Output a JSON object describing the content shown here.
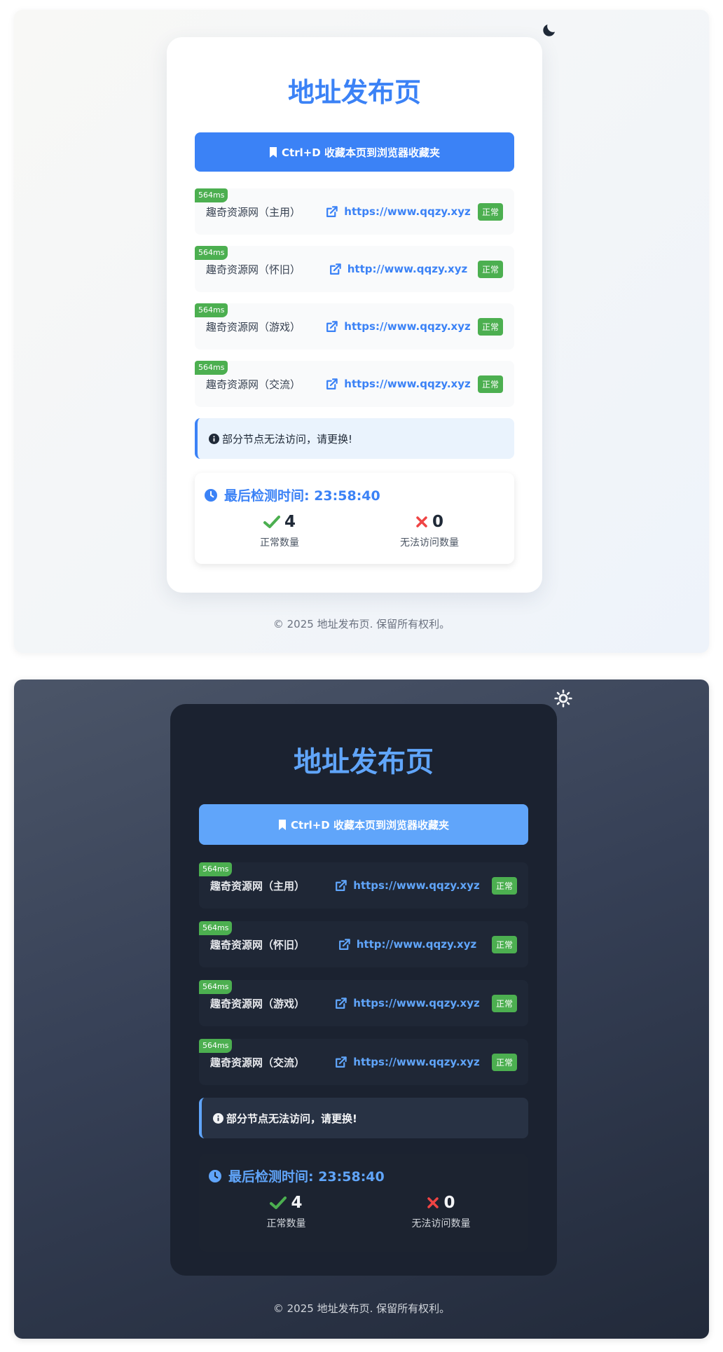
{
  "page": {
    "title": "地址发布页"
  },
  "bookmark": {
    "label": "Ctrl+D 收藏本页到浏览器收藏夹"
  },
  "sites": [
    {
      "latency": "564ms",
      "name": "趣奇资源网（主用）",
      "url": "https://www.qqzy.xyz",
      "status": "正常"
    },
    {
      "latency": "564ms",
      "name": "趣奇资源网（怀旧）",
      "url": "http://www.qqzy.xyz",
      "status": "正常"
    },
    {
      "latency": "564ms",
      "name": "趣奇资源网（游戏）",
      "url": "https://www.qqzy.xyz",
      "status": "正常"
    },
    {
      "latency": "564ms",
      "name": "趣奇资源网（交流）",
      "url": "https://www.qqzy.xyz",
      "status": "正常"
    }
  ],
  "notice": {
    "text": "部分节点无法访问，请更换!"
  },
  "stats": {
    "last_check": "最后检测时间: 23:58:40",
    "ok_count": "4",
    "ok_label": "正常数量",
    "fail_count": "0",
    "fail_label": "无法访问数量"
  },
  "footer": {
    "text": "© 2025 地址发布页. 保留所有权利。"
  },
  "icons": {
    "theme_light": "moon-icon",
    "theme_dark": "sun-icon",
    "bookmark": "bookmark-icon",
    "link": "external-link-icon",
    "notice": "info-circle-icon",
    "clock": "clock-icon",
    "ok": "check-icon",
    "fail": "x-icon"
  },
  "colors": {
    "accent_light": "#3b82f6",
    "accent_dark": "#60a5fa",
    "success": "#4caf50",
    "check": "#4caf50",
    "error": "#ef4444"
  }
}
